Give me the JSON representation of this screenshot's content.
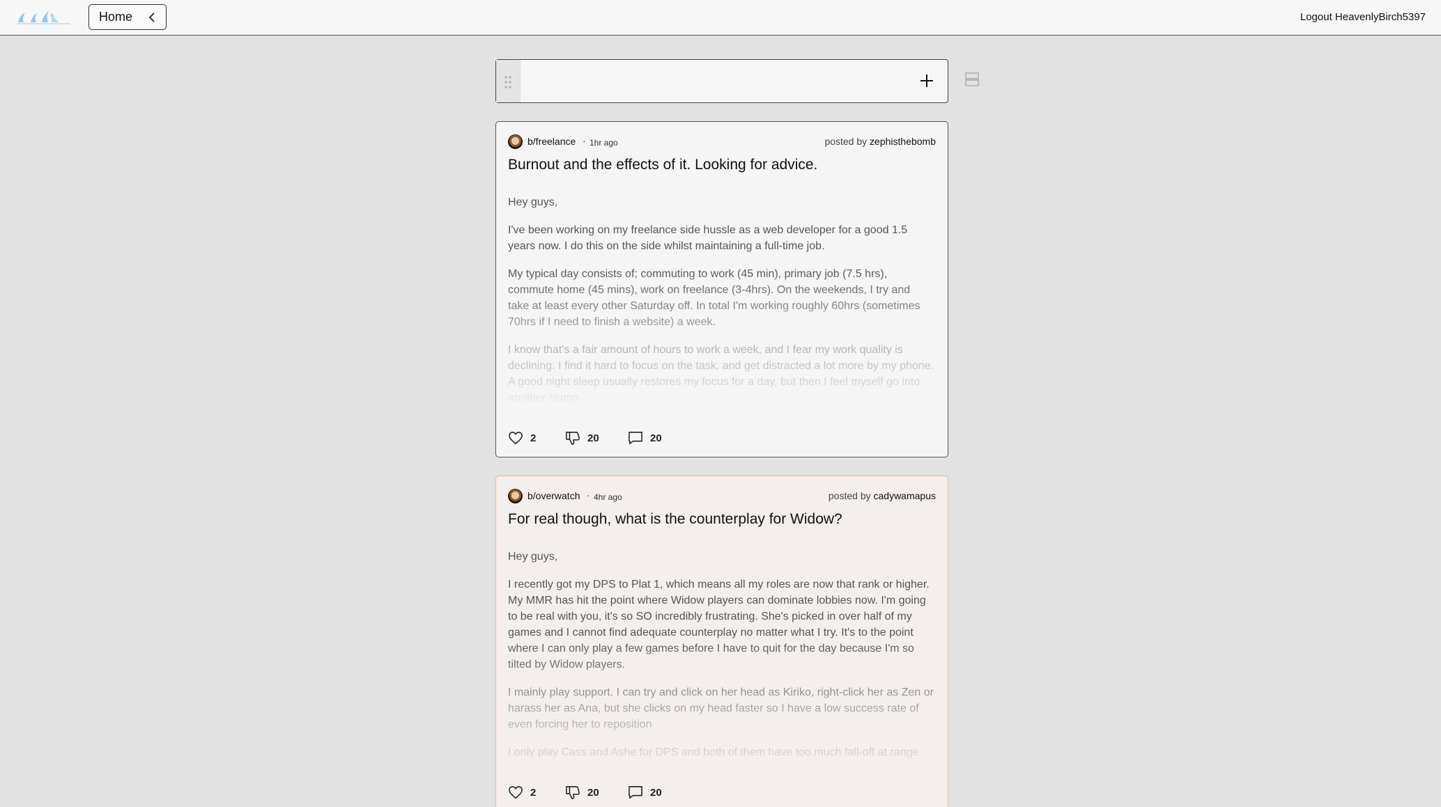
{
  "header": {
    "home_label": "Home",
    "logout_label": "Logout HeavenlyBirch5397"
  },
  "composer": {
    "placeholder": ""
  },
  "posts": [
    {
      "subreddit": "b/freelance",
      "time": "1hr ago",
      "posted_by_prefix": "posted by",
      "author": "zephisthebomb",
      "title": "Burnout and the effects of it. Looking for advice.",
      "paragraphs": [
        "Hey guys,",
        "I've been working on my freelance side hussle as a web developer for a good 1.5 years now. I do this on the side whilst maintaining a full-time job.",
        "My typical day consists of; commuting to work (45 min), primary job (7.5 hrs), commute home (45 mins), work on freelance (3-4hrs). On the weekends, I try and take at least every other Saturday off. In total I'm working roughly 60hrs (sometimes 70hrs if I need to finish a website) a week.",
        "I know that's a fair amount of hours to work a week, and I fear my work quality is declining. I find it hard to focus on the task, and get distracted a lot more by my phone. A good night sleep usually restores my focus for a day, but then I feel myself go into another slump."
      ],
      "likes": "2",
      "dislikes": "20",
      "comments": "20"
    },
    {
      "subreddit": "b/overwatch",
      "time": "4hr ago",
      "posted_by_prefix": "posted by",
      "author": "cadywamapus",
      "title": "For real though, what is the counterplay for Widow?",
      "paragraphs": [
        "Hey guys,",
        "I recently got my DPS to Plat 1, which means all my roles are now that rank or higher. My MMR has hit the point where Widow players can dominate lobbies now. I'm going to be real with you, it's so SO incredibly frustrating. She's picked in over half of my games and I cannot find adequate counterplay no matter what I try. It's to the point where I can only play a few games before I have to quit for the day because I'm so tilted by Widow players.",
        "I mainly play support. I can try and click on her head as Kiriko, right-click her as Zen or harass her as Ana, but she clicks on my head faster so I have a low success rate of even forcing her to reposition",
        "I only play Cass and Ashe for DPS and both of them have too much fall-off at range."
      ],
      "likes": "2",
      "dislikes": "20",
      "comments": "20"
    }
  ],
  "icons": {
    "logo": "site-logo",
    "home_chevron": "chevron-left-icon",
    "drag": "drag-handle-icon",
    "plus": "plus-icon",
    "layout": "layout-rows-icon",
    "like": "heart-icon",
    "dislike": "thumbs-down-icon",
    "comment": "comment-icon"
  },
  "colors": {
    "page_bg": "#e2e2e2",
    "card_bg": "#f5f5f5",
    "card2_bg": "#f4efec",
    "card2_border": "#f0b79a",
    "logo_blue": "#8ec8f0"
  }
}
